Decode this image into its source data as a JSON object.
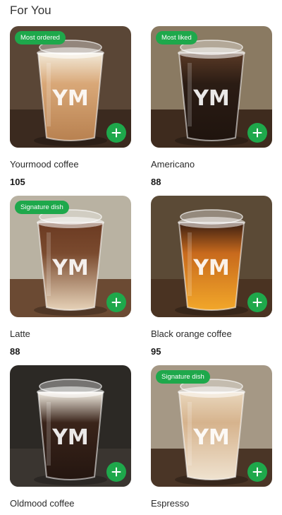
{
  "section": {
    "title": "For You"
  },
  "products": [
    {
      "name": "Yourmood coffee",
      "price": "105",
      "badge": "Most ordered",
      "cup_logo": "YM",
      "drink": "latte",
      "background": "#5a4636",
      "table": "#3b2a1f"
    },
    {
      "name": "Americano",
      "price": "88",
      "badge": "Most liked",
      "cup_logo": "YM",
      "drink": "americano",
      "background": "#8a7a62",
      "table": "#3e2b1e"
    },
    {
      "name": "Latte",
      "price": "88",
      "badge": "Signature dish",
      "cup_logo": "YM",
      "drink": "iced-latte",
      "background": "#b9b2a2",
      "table": "#6b4a33"
    },
    {
      "name": "Black orange coffee",
      "price": "95",
      "badge": "",
      "cup_logo": "YM",
      "drink": "orange",
      "background": "#5b4a36",
      "table": "#4a3322"
    },
    {
      "name": "Oldmood coffee",
      "price": "",
      "badge": "",
      "cup_logo": "YM",
      "drink": "cream-top",
      "background": "#2c2925",
      "table": "#3a3530"
    },
    {
      "name": "Espresso",
      "price": "",
      "badge": "Signature dish",
      "cup_logo": "YM",
      "drink": "cold-latte",
      "background": "#a59885",
      "table": "#4a3526"
    }
  ],
  "colors": {
    "accent": "#1ea84b",
    "badge_text": "#ffffff"
  },
  "icons": {
    "add": "plus-icon"
  }
}
